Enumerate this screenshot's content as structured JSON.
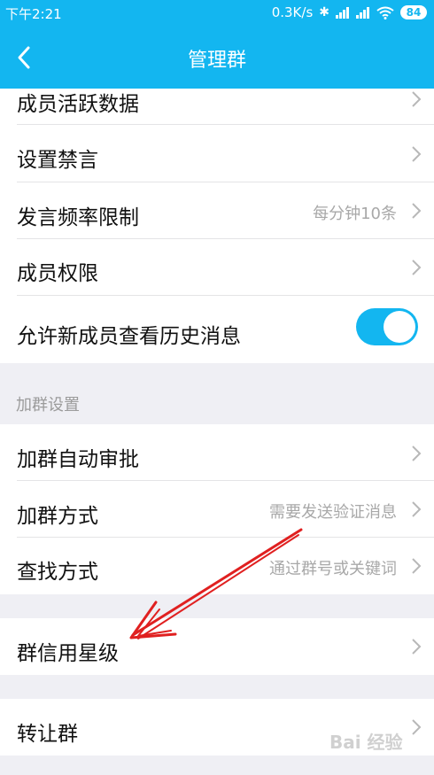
{
  "status_bar": {
    "time": "下午2:21",
    "network_speed": "0.3K/s",
    "battery": "84"
  },
  "header": {
    "title": "管理群"
  },
  "group_management": {
    "items": [
      {
        "label": "成员活跃数据"
      },
      {
        "label": "设置禁言"
      },
      {
        "label": "发言频率限制",
        "value": "每分钟10条"
      },
      {
        "label": "成员权限"
      },
      {
        "label": "允许新成员查看历史消息",
        "toggle_on": true
      }
    ]
  },
  "join_settings": {
    "section_title": "加群设置",
    "items": [
      {
        "label": "加群自动审批"
      },
      {
        "label": "加群方式",
        "value": "需要发送验证消息"
      },
      {
        "label": "查找方式",
        "value": "通过群号或关键词"
      }
    ]
  },
  "credit": {
    "label": "群信用星级"
  },
  "transfer": {
    "label": "转让群"
  },
  "annotation_arrow_color": "#e02020",
  "watermark": "Bai 经验"
}
